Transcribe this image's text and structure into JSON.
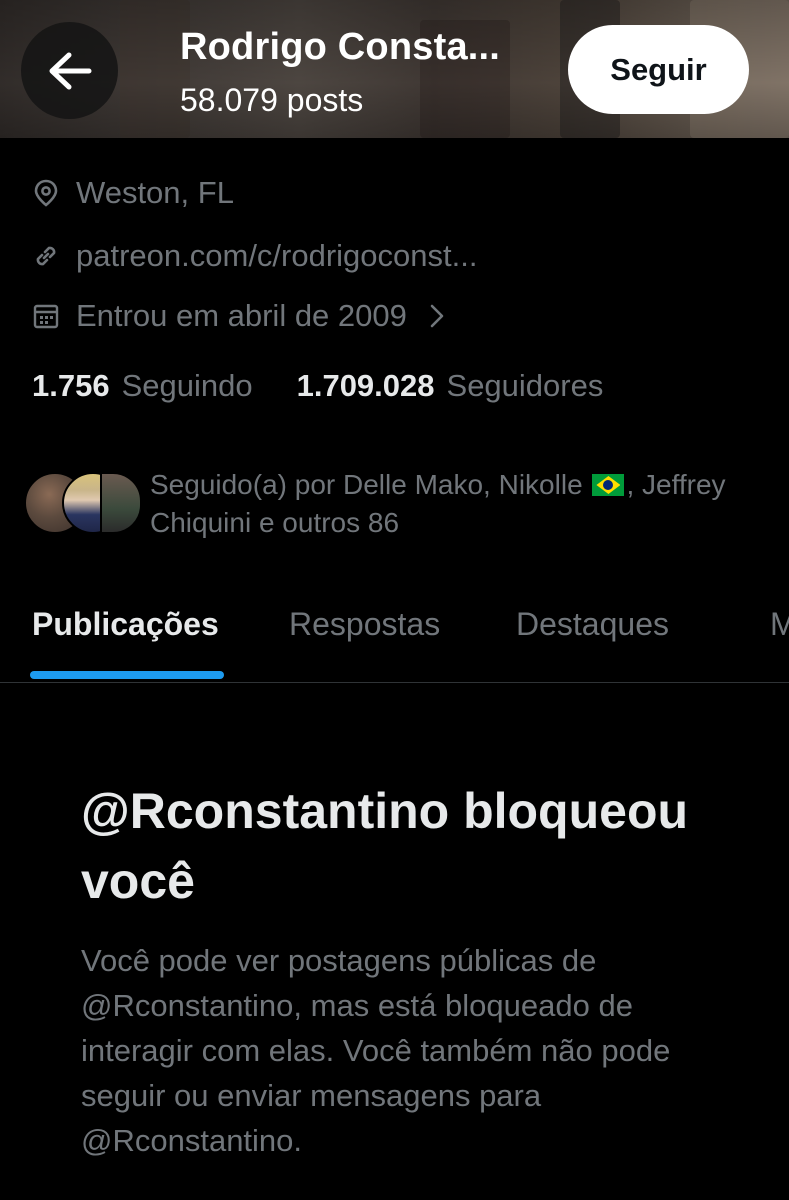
{
  "header": {
    "name": "Rodrigo Consta...",
    "posts": "58.079 posts",
    "follow_label": "Seguir"
  },
  "profile": {
    "location": "Weston, FL",
    "link": "patreon.com/c/rodrigoconst...",
    "joined": "Entrou em abril de 2009"
  },
  "counts": {
    "following_num": "1.756",
    "following_label": "Seguindo",
    "followers_num": "1.709.028",
    "followers_label": "Seguidores"
  },
  "followed_by": {
    "prefix": "Seguido(a) por Delle Mako, Nikolle",
    "suffix": ", Jeffrey Chiquini e outros 86"
  },
  "tabs": [
    {
      "label": "Publicações",
      "active": true
    },
    {
      "label": "Respostas",
      "active": false
    },
    {
      "label": "Destaques",
      "active": false
    },
    {
      "label": "M",
      "active": false
    }
  ],
  "blocked": {
    "title": "@Rconstantino bloqueou você",
    "body": "Você pode ver postagens públicas de @Rconstantino, mas está bloqueado de interagir com elas. Você também não pode seguir ou enviar mensagens para @Rconstantino."
  },
  "icons": {
    "back": "arrow-left-icon",
    "location": "map-pin-icon",
    "link": "link-icon",
    "calendar": "calendar-icon",
    "chevron": "chevron-right-icon",
    "flag": "brazil-flag-icon"
  },
  "colors": {
    "background": "#000000",
    "primary_text": "#e7e9ea",
    "secondary_text": "#71767b",
    "accent": "#1d9bf0",
    "button_bg": "#ffffff"
  }
}
